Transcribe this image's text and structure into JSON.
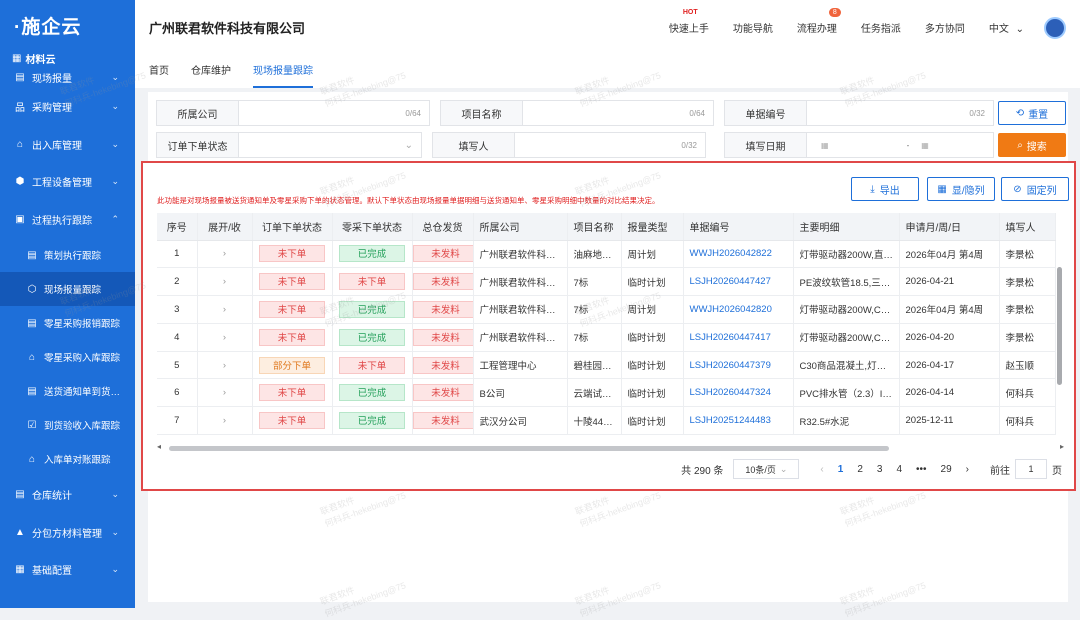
{
  "brand": {
    "logo": "·施企云"
  },
  "sidebar": {
    "group_label": "材料云",
    "items": [
      {
        "label": "现场报量",
        "icon": "grid-icon"
      },
      {
        "label": "采购管理",
        "icon": "sitemap-icon"
      },
      {
        "label": "出入库管理",
        "icon": "home-icon"
      },
      {
        "label": "工程设备管理",
        "icon": "cube-icon"
      },
      {
        "label": "过程执行跟踪",
        "icon": "file-icon"
      }
    ],
    "sub_items": [
      {
        "label": "策划执行跟踪"
      },
      {
        "label": "现场报量跟踪"
      },
      {
        "label": "零星采购报销跟踪"
      },
      {
        "label": "零星采购入库跟踪"
      },
      {
        "label": "送货通知单到货…"
      },
      {
        "label": "到货验收入库跟踪"
      },
      {
        "label": "入库单对账跟踪"
      }
    ],
    "bottom_items": [
      {
        "label": "仓库统计"
      },
      {
        "label": "分包方材料管理"
      },
      {
        "label": "基础配置"
      }
    ]
  },
  "header": {
    "company": "广州联君软件科技有限公司",
    "nav": [
      "快速上手",
      "功能导航",
      "流程办理",
      "任务指派",
      "多方协同",
      "中文"
    ],
    "hot_label": "HOT",
    "badge_count": "8"
  },
  "tabs": [
    "首页",
    "仓库维护",
    "现场报量跟踪"
  ],
  "filters": {
    "company_label": "所属公司",
    "company_count": "0/64",
    "project_label": "项目名称",
    "project_count": "0/64",
    "doc_label": "单据编号",
    "doc_count": "0/32",
    "order_status_label": "订单下单状态",
    "filler_label": "填写人",
    "filler_count": "0/32",
    "date_label": "填写日期",
    "date_sep": "-",
    "reset_label": "重置",
    "search_label": "搜索"
  },
  "toolbar": {
    "export_label": "导出",
    "toggle_label": "显/隐列",
    "pin_label": "固定列",
    "notice": "此功能是对现场报量被送货通知单及零星采购下单的状态管理。默认下单状态由现场报量单据明细与送货通知单、零星采购明细中数量的对比结果决定。"
  },
  "table": {
    "headers": [
      "序号",
      "展开/收",
      "订单下单状态",
      "零采下单状态",
      "总仓发货",
      "所属公司",
      "项目名称",
      "报量类型",
      "单据编号",
      "主要明细",
      "申请月/周/日",
      "填写人"
    ],
    "rows": [
      [
        "1",
        "›",
        "未下单",
        "已完成",
        "未发料",
        "广州联君软件科…",
        "油麻地…",
        "周计划",
        "WWJH2026042822",
        "灯带驱动器200W,直…",
        "2026年04月 第4周",
        "李景松"
      ],
      [
        "2",
        "›",
        "未下单",
        "未下单",
        "未发料",
        "广州联君软件科…",
        "7标",
        "临时计划",
        "LSJH20260447427",
        "PE波纹软管18.5,三…",
        "2026-04-21",
        "李景松"
      ],
      [
        "3",
        "›",
        "未下单",
        "已完成",
        "未发料",
        "广州联君软件科…",
        "7标",
        "周计划",
        "WWJH2026042820",
        "灯带驱动器200W,C…",
        "2026年04月 第4周",
        "李景松"
      ],
      [
        "4",
        "›",
        "未下单",
        "已完成",
        "未发料",
        "广州联君软件科…",
        "7标",
        "临时计划",
        "LSJH20260447417",
        "灯带驱动器200W,C…",
        "2026-04-20",
        "李景松"
      ],
      [
        "5",
        "›",
        "部分下单",
        "未下单",
        "未发料",
        "工程管理中心",
        "碧桂园…",
        "临时计划",
        "LSJH20260447379",
        "C30商品混凝土,灯…",
        "2026-04-17",
        "赵玉顺"
      ],
      [
        "6",
        "›",
        "未下单",
        "已完成",
        "未发料",
        "B公司",
        "云端试…",
        "临时计划",
        "LSJH20260447324",
        "PVC排水管（2.3）I…",
        "2026-04-14",
        "何科兵"
      ],
      [
        "7",
        "›",
        "未下单",
        "已完成",
        "未发料",
        "武汉分公司",
        "十陵44…",
        "临时计划",
        "LSJH20251244483",
        "R32.5#水泥",
        "2025-12-11",
        "何科兵"
      ]
    ]
  },
  "pager": {
    "total": "共 290 条",
    "size": "10条/页",
    "pages": [
      "1",
      "2",
      "3",
      "4",
      "•••",
      "29"
    ],
    "goto": "前往",
    "current": "1",
    "unit": "页"
  },
  "watermark": {
    "line1": "联君软件",
    "line2": "何科兵-hekebing@75"
  }
}
